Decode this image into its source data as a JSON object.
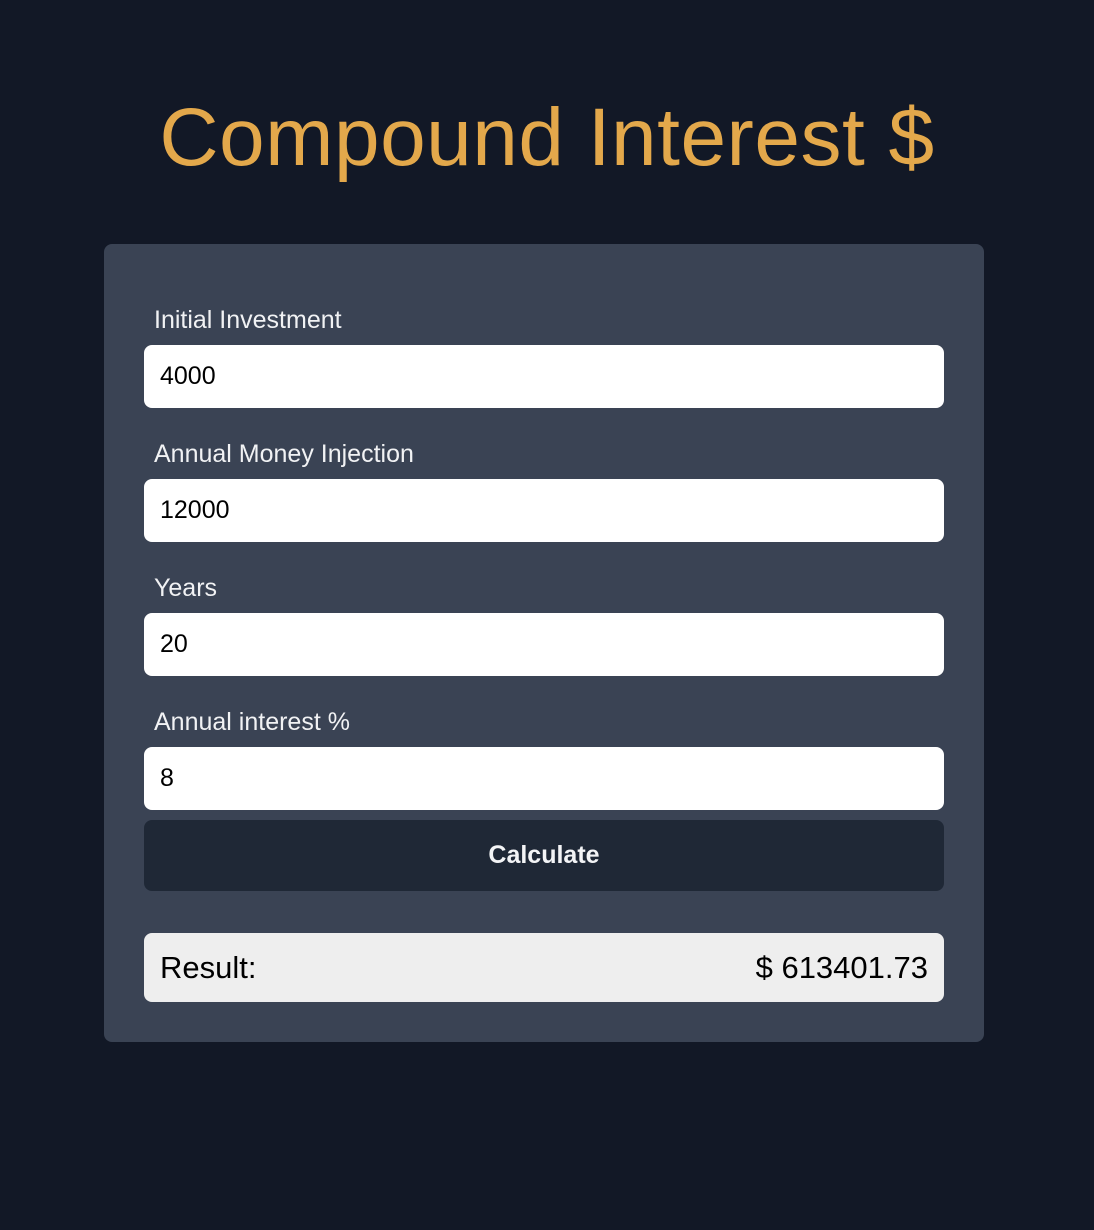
{
  "header": {
    "title": "Compound Interest $"
  },
  "form": {
    "fields": [
      {
        "label": "Initial Investment",
        "value": "4000"
      },
      {
        "label": "Annual Money Injection",
        "value": "12000"
      },
      {
        "label": "Years",
        "value": "20"
      },
      {
        "label": "Annual interest %",
        "value": "8"
      }
    ],
    "calculate_label": "Calculate"
  },
  "result": {
    "label": "Result:",
    "value": "$ 613401.73"
  },
  "colors": {
    "background": "#121826",
    "card": "#3a4354",
    "title": "#e3a84b",
    "button": "#1f2836",
    "result_box": "#eeeeee"
  }
}
